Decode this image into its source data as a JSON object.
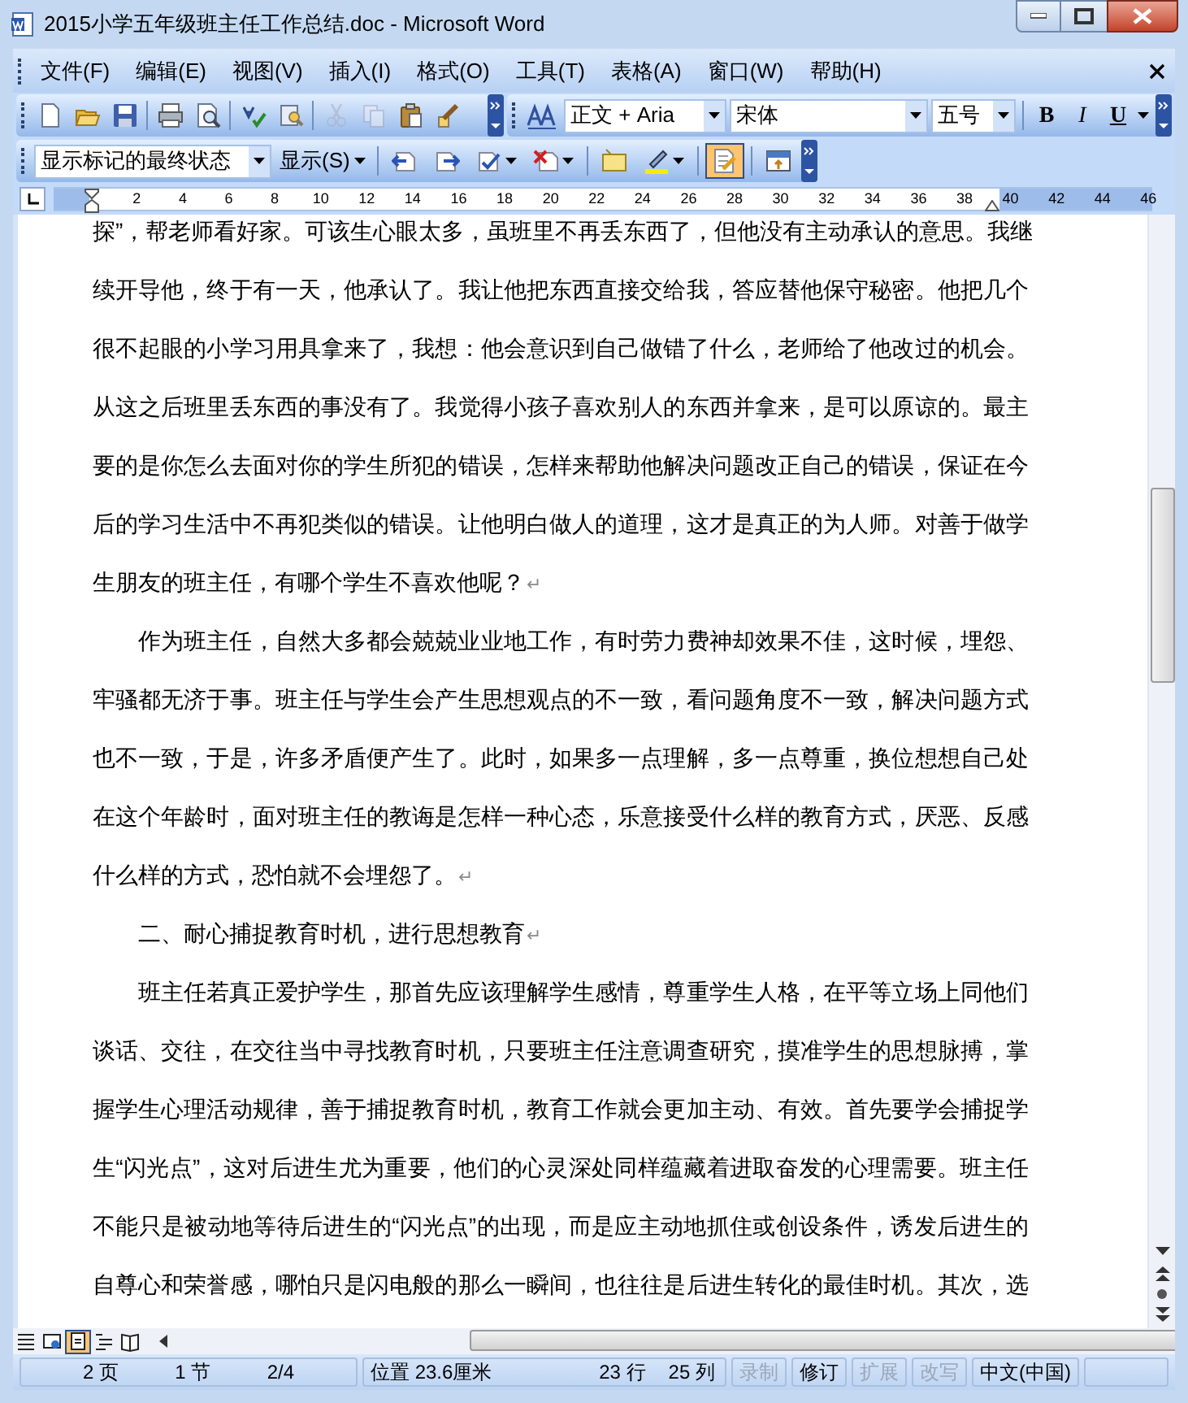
{
  "window": {
    "title": "2015小学五年级班主任工作总结.doc - Microsoft Word"
  },
  "menu": {
    "items": [
      "文件(F)",
      "编辑(E)",
      "视图(V)",
      "插入(I)",
      "格式(O)",
      "工具(T)",
      "表格(A)",
      "窗口(W)",
      "帮助(H)"
    ]
  },
  "standard_toolbar": {
    "buttons": [
      {
        "disabled": false
      },
      {
        "disabled": false
      },
      {
        "disabled": false
      },
      {
        "disabled": false
      },
      {
        "disabled": false
      },
      {
        "disabled": false
      },
      {
        "disabled": false
      },
      {
        "disabled": true
      },
      {
        "disabled": true
      },
      {
        "disabled": false
      },
      {
        "disabled": false
      }
    ]
  },
  "formatting_toolbar": {
    "style": "正文 + Aria",
    "font": "宋体",
    "size": "五号",
    "buttons": [
      "B",
      "I",
      "U"
    ]
  },
  "reviewing_toolbar": {
    "display_mode": "显示标记的最终状态",
    "show_menu": "显示(S)",
    "buttons": [
      {
        "selected": false
      },
      {
        "selected": false
      },
      {
        "selected": false
      },
      {
        "selected": false
      },
      {
        "selected": false
      },
      {
        "selected": false
      },
      {
        "selected": true
      },
      {
        "selected": false
      }
    ]
  },
  "ruler": {
    "numbers": [
      "2",
      "4",
      "6",
      "8",
      "10",
      "12",
      "14",
      "16",
      "18",
      "20",
      "22",
      "24",
      "26",
      "28",
      "30",
      "32",
      "34",
      "36",
      "38",
      "40",
      "42",
      "44",
      "46"
    ]
  },
  "document": {
    "paragraphs": [
      {
        "first_line_indent": false,
        "end_mark": "↵",
        "lines": [
          "探”，帮老师看好家。可该生心眼太多，虽班里不再丢东西了，但他没有主动承认的意思。我继",
          "续开导他，终于有一天，他承认了。我让他把东西直接交给我，答应替他保守秘密。他把几个",
          "很不起眼的小学习用具拿来了，我想：他会意识到自己做错了什么，老师给了他改过的机会。",
          "从这之后班里丢东西的事没有了。我觉得小孩子喜欢别人的东西并拿来，是可以原谅的。最主",
          "要的是你怎么去面对你的学生所犯的错误，怎样来帮助他解决问题改正自己的错误，保证在今",
          "后的学习生活中不再犯类似的错误。让他明白做人的道理，这才是真正的为人师。对善于做学",
          "生朋友的班主任，有哪个学生不喜欢他呢？"
        ]
      },
      {
        "first_line_indent": true,
        "end_mark": "↵",
        "lines": [
          "作为班主任，自然大多都会兢兢业业地工作，有时劳力费神却效果不佳，这时候，埋怨、",
          "牢骚都无济于事。班主任与学生会产生思想观点的不一致，看问题角度不一致，解决问题方式",
          "也不一致，于是，许多矛盾便产生了。此时，如果多一点理解，多一点尊重，换位想想自己处",
          "在这个年龄时，面对班主任的教诲是怎样一种心态，乐意接受什么样的教育方式，厌恶、反感",
          "什么样的方式，恐怕就不会埋怨了。"
        ]
      },
      {
        "first_line_indent": true,
        "end_mark": "↵",
        "lines": [
          "二、耐心捕捉教育时机，进行思想教育"
        ]
      },
      {
        "first_line_indent": true,
        "lines": [
          "班主任若真正爱护学生，那首先应该理解学生感情，尊重学生人格，在平等立场上同他们",
          "谈话、交往，在交往当中寻找教育时机，只要班主任注意调查研究，摸准学生的思想脉搏，掌",
          "握学生心理活动规律，善于捕捉教育时机，教育工作就会更加主动、有效。首先要学会捕捉学",
          "生“闪光点”，这对后进生尤为重要，他们的心灵深处同样蕴藏着进取奋发的心理需要。班主任",
          "不能只是被动地等待后进生的“闪光点”的出现，而是应主动地抓住或创设条件，诱发后进生的",
          "自尊心和荣誉感，哪怕只是闪电般的那么一瞬间，也往往是后进生转化的最佳时机。其次，选"
        ]
      }
    ]
  },
  "view_buttons": [
    {
      "selected": false
    },
    {
      "selected": false
    },
    {
      "selected": true
    },
    {
      "selected": false
    },
    {
      "selected": false
    }
  ],
  "status_bar": {
    "panes": [
      {
        "disabled": false,
        "fields": [
          "2 页",
          "1 节",
          "2/4"
        ]
      },
      {
        "disabled": false,
        "fields": [
          "位置 23.6厘米",
          "23 行",
          "25 列"
        ]
      },
      {
        "disabled": true,
        "fields": [
          "录制"
        ]
      },
      {
        "disabled": false,
        "fields": [
          "修订"
        ]
      },
      {
        "disabled": true,
        "fields": [
          "扩展"
        ]
      },
      {
        "disabled": true,
        "fields": [
          "改写"
        ]
      },
      {
        "disabled": false,
        "fields": [
          "中文(中国)"
        ]
      }
    ]
  }
}
